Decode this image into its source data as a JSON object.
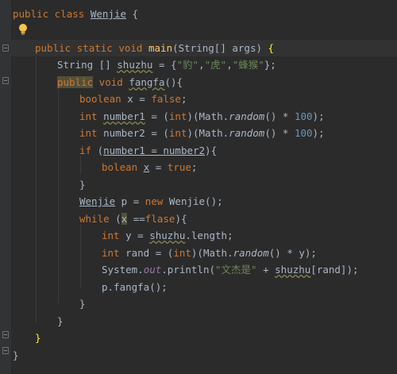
{
  "editor": {
    "lines": [
      {
        "indent": 0,
        "tokens": [
          {
            "t": "kw",
            "v": "public class "
          },
          {
            "t": "plainul",
            "v": "Wenjie"
          },
          {
            "t": "plain",
            "v": " {"
          }
        ]
      },
      {
        "indent": 0,
        "tokens": []
      },
      {
        "indent": 2,
        "tokens": [
          {
            "t": "kw",
            "v": "public static void "
          },
          {
            "t": "fn",
            "v": "main"
          },
          {
            "t": "plain",
            "v": "(String[] args) "
          },
          {
            "t": "braceY",
            "v": "{"
          }
        ]
      },
      {
        "indent": 4,
        "tokens": [
          {
            "t": "plain",
            "v": "String [] "
          },
          {
            "t": "squig",
            "v": "shuzhu"
          },
          {
            "t": "plain",
            "v": " = {"
          },
          {
            "t": "str",
            "v": "\"豹\""
          },
          {
            "t": "plain",
            "v": ","
          },
          {
            "t": "str",
            "v": "\"虎\""
          },
          {
            "t": "plain",
            "v": ","
          },
          {
            "t": "str",
            "v": "\"蜂猴\""
          },
          {
            "t": "plain",
            "v": "};"
          }
        ]
      },
      {
        "indent": 4,
        "tokens": [
          {
            "t": "kwwarn",
            "v": "public"
          },
          {
            "t": "kw",
            "v": " void "
          },
          {
            "t": "squig",
            "v": "fangfa"
          },
          {
            "t": "plain",
            "v": "(){"
          }
        ]
      },
      {
        "indent": 6,
        "tokens": [
          {
            "t": "kw",
            "v": "boolean "
          },
          {
            "t": "plain",
            "v": "x = "
          },
          {
            "t": "kw",
            "v": "false"
          },
          {
            "t": "plain",
            "v": ";"
          }
        ]
      },
      {
        "indent": 6,
        "tokens": [
          {
            "t": "kw",
            "v": "int "
          },
          {
            "t": "squig",
            "v": "number1"
          },
          {
            "t": "plain",
            "v": " = ("
          },
          {
            "t": "kw",
            "v": "int"
          },
          {
            "t": "plain",
            "v": ")(Math."
          },
          {
            "t": "ital",
            "v": "random"
          },
          {
            "t": "plain",
            "v": "() * "
          },
          {
            "t": "num",
            "v": "100"
          },
          {
            "t": "plain",
            "v": ");"
          }
        ]
      },
      {
        "indent": 6,
        "tokens": [
          {
            "t": "kw",
            "v": "int "
          },
          {
            "t": "plain",
            "v": "number2 = ("
          },
          {
            "t": "kw",
            "v": "int"
          },
          {
            "t": "plain",
            "v": ")(Math."
          },
          {
            "t": "ital",
            "v": "random"
          },
          {
            "t": "plain",
            "v": "() * "
          },
          {
            "t": "num",
            "v": "100"
          },
          {
            "t": "plain",
            "v": ");"
          }
        ]
      },
      {
        "indent": 6,
        "tokens": [
          {
            "t": "kw",
            "v": "if "
          },
          {
            "t": "plain",
            "v": "("
          },
          {
            "t": "ul",
            "v": "number1 = number2"
          },
          {
            "t": "plain",
            "v": "){"
          }
        ]
      },
      {
        "indent": 8,
        "tokens": [
          {
            "t": "kw",
            "v": "bolean "
          },
          {
            "t": "ul",
            "v": "x"
          },
          {
            "t": "plain",
            "v": " = "
          },
          {
            "t": "kw",
            "v": "true"
          },
          {
            "t": "plain",
            "v": ";"
          }
        ]
      },
      {
        "indent": 6,
        "tokens": [
          {
            "t": "plain",
            "v": "}"
          }
        ]
      },
      {
        "indent": 6,
        "tokens": [
          {
            "t": "plainul",
            "v": "Wenjie"
          },
          {
            "t": "plain",
            "v": " p = "
          },
          {
            "t": "kw",
            "v": "new "
          },
          {
            "t": "plain",
            "v": "Wenjie();"
          }
        ]
      },
      {
        "indent": 6,
        "tokens": [
          {
            "t": "kw",
            "v": "while "
          },
          {
            "t": "plain",
            "v": "("
          },
          {
            "t": "warnbg",
            "v": "x"
          },
          {
            "t": "plain",
            "v": " =="
          },
          {
            "t": "kw",
            "v": "flase"
          },
          {
            "t": "plain",
            "v": "){"
          }
        ]
      },
      {
        "indent": 8,
        "tokens": [
          {
            "t": "kw",
            "v": "int "
          },
          {
            "t": "plain",
            "v": "y = "
          },
          {
            "t": "squig",
            "v": "shuzhu"
          },
          {
            "t": "plain",
            "v": ".length;"
          }
        ]
      },
      {
        "indent": 8,
        "tokens": [
          {
            "t": "kw",
            "v": "int "
          },
          {
            "t": "plain",
            "v": "rand = ("
          },
          {
            "t": "kw",
            "v": "int"
          },
          {
            "t": "plain",
            "v": ")(Math."
          },
          {
            "t": "ital",
            "v": "random"
          },
          {
            "t": "plain",
            "v": "() * y);"
          }
        ]
      },
      {
        "indent": 8,
        "tokens": [
          {
            "t": "plain",
            "v": "System."
          },
          {
            "t": "fieldital",
            "v": "out"
          },
          {
            "t": "plain",
            "v": ".println("
          },
          {
            "t": "str",
            "v": "\"文杰是\""
          },
          {
            "t": "plain",
            "v": " + "
          },
          {
            "t": "squig",
            "v": "shuzhu"
          },
          {
            "t": "plain",
            "v": "[rand]);"
          }
        ]
      },
      {
        "indent": 8,
        "tokens": [
          {
            "t": "plain",
            "v": "p.fangfa();"
          }
        ]
      },
      {
        "indent": 6,
        "tokens": [
          {
            "t": "plain",
            "v": "}"
          }
        ]
      },
      {
        "indent": 4,
        "tokens": [
          {
            "t": "plain",
            "v": "}"
          }
        ]
      },
      {
        "indent": 2,
        "tokens": [
          {
            "t": "braceY",
            "v": "}"
          }
        ]
      },
      {
        "indent": 0,
        "tokens": [
          {
            "t": "plain",
            "v": "}"
          }
        ]
      }
    ]
  },
  "icons": {
    "intention_bulb": "lightbulb-icon",
    "fold_marker": "fold-marker-icon"
  },
  "colors": {
    "background": "#2b2b2b",
    "keyword": "#cc7832",
    "method": "#ffc66d",
    "string": "#6a8759",
    "number": "#6897bb",
    "field": "#9876aa",
    "text": "#a9b7c6"
  }
}
